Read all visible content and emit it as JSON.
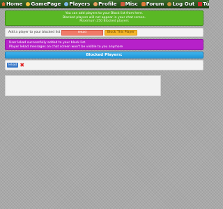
{
  "nav": {
    "items": [
      {
        "label": "Home",
        "icon": "home-icon"
      },
      {
        "label": "GamePage",
        "icon": "game-icon"
      },
      {
        "label": "Players",
        "icon": "players-icon"
      },
      {
        "label": "Profile",
        "icon": "profile-icon"
      },
      {
        "label": "Misc",
        "icon": "misc-icon"
      },
      {
        "label": "Forum",
        "icon": "forum-icon"
      },
      {
        "label": "Log Out",
        "icon": "logout-icon"
      },
      {
        "label": "Türkç",
        "icon": "flag-icon"
      }
    ]
  },
  "info": {
    "line1": "You can add players to your Block list from here.",
    "line2": "Blocked players will not appear in your chat screen.",
    "line3": "Maximum 250 Blocked players"
  },
  "add_form": {
    "label": "Add a player to your blocked list",
    "input_value": "lekad",
    "button_label": "Block This Player"
  },
  "message": {
    "line1": "User lekad successfully added to your block list.",
    "line2": "Player lekad messages on chat screen won't be visible to you anymore"
  },
  "blocked": {
    "header": "Blocked Players:",
    "players": [
      "lekad"
    ]
  },
  "colors": {
    "nav_bg": "#2d5a22",
    "info_green": "#5ab825",
    "input_red": "#f07a68",
    "button_orange": "#f5b52a",
    "message_purple": "#b621c9",
    "header_blue": "#2aa4e2"
  }
}
